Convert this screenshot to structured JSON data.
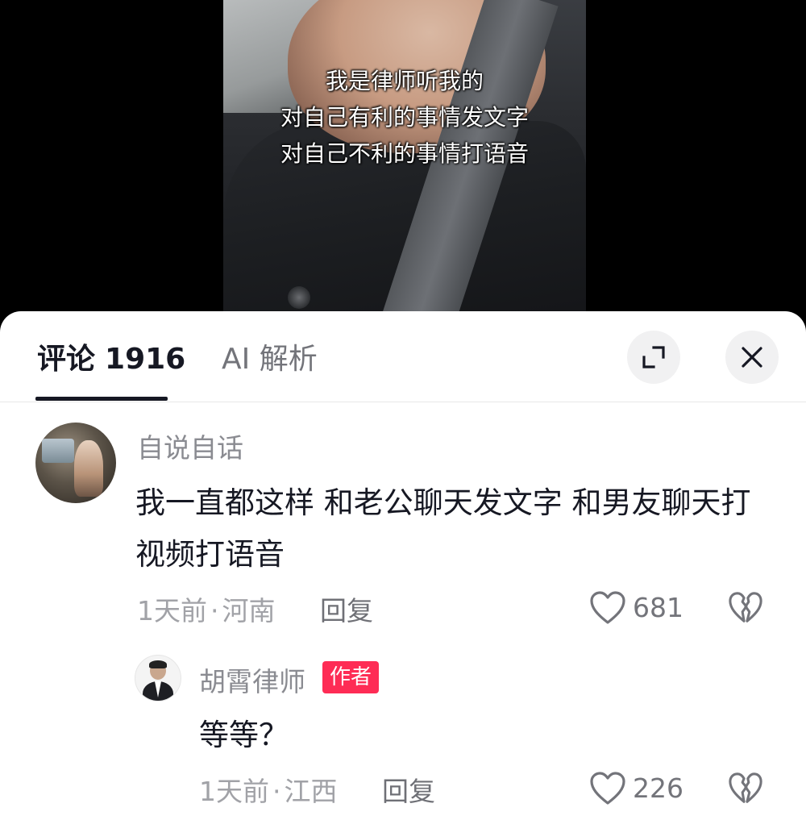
{
  "video": {
    "caption_lines": [
      "我是律师听我的",
      "对自己有利的事情发文字",
      "对自己不利的事情打语音"
    ]
  },
  "header": {
    "tabs": [
      {
        "label": "评论",
        "count": "1916",
        "active": true
      },
      {
        "label": "AI 解析",
        "active": false
      }
    ],
    "expand_icon": "expand-icon",
    "close_icon": "close-icon"
  },
  "comments": [
    {
      "username": "自说自话",
      "text": "我一直都这样 和老公聊天发文字  和男友聊天打视频打语音",
      "time": "1天前",
      "location": "河南",
      "reply_label": "回复",
      "likes": "681"
    }
  ],
  "reply": {
    "username": "胡霄律师",
    "badge": "作者",
    "text": "等等？",
    "time": "1天前",
    "location": "江西",
    "reply_label": "回复",
    "likes": "226"
  },
  "colors": {
    "accent": "#fe2c55",
    "text_primary": "#161823",
    "text_secondary": "#8a8b91"
  }
}
